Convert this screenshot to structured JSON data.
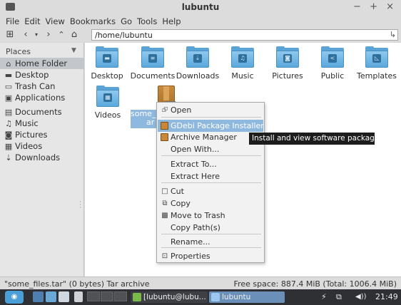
{
  "window": {
    "title": "lubuntu",
    "controls": "− + ×"
  },
  "menu": [
    "File",
    "Edit",
    "View",
    "Bookmarks",
    "Go",
    "Tools",
    "Help"
  ],
  "toolbar": {
    "path": "/home/lubuntu"
  },
  "sidebar": {
    "header": "Places",
    "items": [
      {
        "label": "Home Folder",
        "icon": "home-icon",
        "glyph": "⌂",
        "selected": true
      },
      {
        "label": "Desktop",
        "icon": "desktop-icon",
        "glyph": "▬"
      },
      {
        "label": "Trash Can",
        "icon": "trash-icon",
        "glyph": "▭"
      },
      {
        "label": "Applications",
        "icon": "applications-icon",
        "glyph": "▣"
      },
      {
        "label": "Documents",
        "icon": "documents-icon",
        "glyph": "▤"
      },
      {
        "label": "Music",
        "icon": "music-icon",
        "glyph": "♫"
      },
      {
        "label": "Pictures",
        "icon": "pictures-icon",
        "glyph": "◙"
      },
      {
        "label": "Videos",
        "icon": "videos-icon",
        "glyph": "▦"
      },
      {
        "label": "Downloads",
        "icon": "downloads-icon",
        "glyph": "⇣"
      }
    ]
  },
  "files": [
    {
      "label": "Desktop",
      "icon": "folder-desktop-icon",
      "emblem": "▬"
    },
    {
      "label": "Documents",
      "icon": "folder-documents-icon",
      "emblem": "≡"
    },
    {
      "label": "Downloads",
      "icon": "folder-downloads-icon",
      "emblem": "⇣"
    },
    {
      "label": "Music",
      "icon": "folder-music-icon",
      "emblem": "♫"
    },
    {
      "label": "Pictures",
      "icon": "folder-pictures-icon",
      "emblem": "◙"
    },
    {
      "label": "Public",
      "icon": "folder-public-icon",
      "emblem": "<"
    },
    {
      "label": "Templates",
      "icon": "folder-templates-icon",
      "emblem": "◺"
    },
    {
      "label": "Videos",
      "icon": "folder-videos-icon",
      "emblem": "▦"
    }
  ],
  "selected_file": {
    "label_line1": "some_f",
    "label_line2": "ar",
    "icon": "archive-icon"
  },
  "context_menu": {
    "items": [
      {
        "label": "Open",
        "icon": "open-icon",
        "glyph": "⮺"
      },
      {
        "label": "GDebi Package Installer",
        "icon": "gdebi-icon",
        "highlighted": true
      },
      {
        "label": "Archive Manager",
        "icon": "archive-manager-icon"
      },
      {
        "label": "Open With...",
        "icon": ""
      },
      {
        "label": "Extract To...",
        "icon": ""
      },
      {
        "label": "Extract Here",
        "icon": ""
      },
      {
        "label": "Cut",
        "icon": "cut-icon",
        "glyph": "□"
      },
      {
        "label": "Copy",
        "icon": "copy-icon",
        "glyph": "⧉"
      },
      {
        "label": "Move to Trash",
        "icon": "trash-icon",
        "glyph": "▩"
      },
      {
        "label": "Copy Path(s)",
        "icon": ""
      },
      {
        "label": "Rename...",
        "icon": ""
      },
      {
        "label": "Properties",
        "icon": "properties-icon",
        "glyph": "⊡"
      }
    ]
  },
  "tooltip": "Install and view software packages",
  "status": {
    "left": "\"some_files.tar\" (0 bytes) Tar archive",
    "right": "Free space: 887.4 MiB (Total: 1006.4 MiB)"
  },
  "taskbar": {
    "tasks": [
      {
        "label": "[lubuntu@lubu...",
        "icon": "terminal-icon"
      },
      {
        "label": "lubuntu",
        "icon": "file-manager-icon"
      }
    ],
    "clock": "21:49",
    "tray_glyphs": {
      "battery": "⚡",
      "network": "🖧",
      "volume": "◀))"
    }
  },
  "colors": {
    "selection": "#8fb8de",
    "folder": "#5aa3d6",
    "taskbar": "#2f3034",
    "tooltip": "#1d1d1d"
  }
}
